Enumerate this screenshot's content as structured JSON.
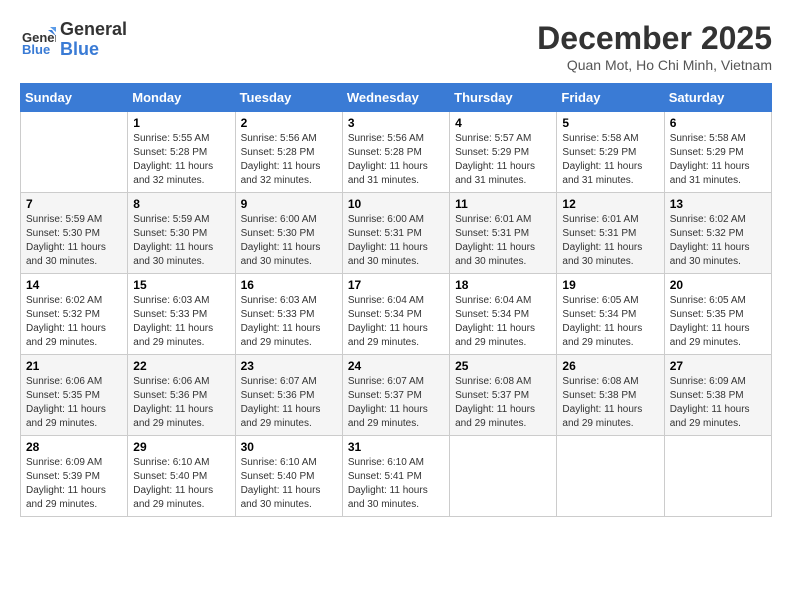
{
  "header": {
    "logo_general": "General",
    "logo_blue": "Blue",
    "month_title": "December 2025",
    "location": "Quan Mot, Ho Chi Minh, Vietnam"
  },
  "days_of_week": [
    "Sunday",
    "Monday",
    "Tuesday",
    "Wednesday",
    "Thursday",
    "Friday",
    "Saturday"
  ],
  "weeks": [
    [
      {
        "day": "",
        "sunrise": "",
        "sunset": "",
        "daylight": ""
      },
      {
        "day": "1",
        "sunrise": "Sunrise: 5:55 AM",
        "sunset": "Sunset: 5:28 PM",
        "daylight": "Daylight: 11 hours and 32 minutes."
      },
      {
        "day": "2",
        "sunrise": "Sunrise: 5:56 AM",
        "sunset": "Sunset: 5:28 PM",
        "daylight": "Daylight: 11 hours and 32 minutes."
      },
      {
        "day": "3",
        "sunrise": "Sunrise: 5:56 AM",
        "sunset": "Sunset: 5:28 PM",
        "daylight": "Daylight: 11 hours and 31 minutes."
      },
      {
        "day": "4",
        "sunrise": "Sunrise: 5:57 AM",
        "sunset": "Sunset: 5:29 PM",
        "daylight": "Daylight: 11 hours and 31 minutes."
      },
      {
        "day": "5",
        "sunrise": "Sunrise: 5:58 AM",
        "sunset": "Sunset: 5:29 PM",
        "daylight": "Daylight: 11 hours and 31 minutes."
      },
      {
        "day": "6",
        "sunrise": "Sunrise: 5:58 AM",
        "sunset": "Sunset: 5:29 PM",
        "daylight": "Daylight: 11 hours and 31 minutes."
      }
    ],
    [
      {
        "day": "7",
        "sunrise": "Sunrise: 5:59 AM",
        "sunset": "Sunset: 5:30 PM",
        "daylight": "Daylight: 11 hours and 30 minutes."
      },
      {
        "day": "8",
        "sunrise": "Sunrise: 5:59 AM",
        "sunset": "Sunset: 5:30 PM",
        "daylight": "Daylight: 11 hours and 30 minutes."
      },
      {
        "day": "9",
        "sunrise": "Sunrise: 6:00 AM",
        "sunset": "Sunset: 5:30 PM",
        "daylight": "Daylight: 11 hours and 30 minutes."
      },
      {
        "day": "10",
        "sunrise": "Sunrise: 6:00 AM",
        "sunset": "Sunset: 5:31 PM",
        "daylight": "Daylight: 11 hours and 30 minutes."
      },
      {
        "day": "11",
        "sunrise": "Sunrise: 6:01 AM",
        "sunset": "Sunset: 5:31 PM",
        "daylight": "Daylight: 11 hours and 30 minutes."
      },
      {
        "day": "12",
        "sunrise": "Sunrise: 6:01 AM",
        "sunset": "Sunset: 5:31 PM",
        "daylight": "Daylight: 11 hours and 30 minutes."
      },
      {
        "day": "13",
        "sunrise": "Sunrise: 6:02 AM",
        "sunset": "Sunset: 5:32 PM",
        "daylight": "Daylight: 11 hours and 30 minutes."
      }
    ],
    [
      {
        "day": "14",
        "sunrise": "Sunrise: 6:02 AM",
        "sunset": "Sunset: 5:32 PM",
        "daylight": "Daylight: 11 hours and 29 minutes."
      },
      {
        "day": "15",
        "sunrise": "Sunrise: 6:03 AM",
        "sunset": "Sunset: 5:33 PM",
        "daylight": "Daylight: 11 hours and 29 minutes."
      },
      {
        "day": "16",
        "sunrise": "Sunrise: 6:03 AM",
        "sunset": "Sunset: 5:33 PM",
        "daylight": "Daylight: 11 hours and 29 minutes."
      },
      {
        "day": "17",
        "sunrise": "Sunrise: 6:04 AM",
        "sunset": "Sunset: 5:34 PM",
        "daylight": "Daylight: 11 hours and 29 minutes."
      },
      {
        "day": "18",
        "sunrise": "Sunrise: 6:04 AM",
        "sunset": "Sunset: 5:34 PM",
        "daylight": "Daylight: 11 hours and 29 minutes."
      },
      {
        "day": "19",
        "sunrise": "Sunrise: 6:05 AM",
        "sunset": "Sunset: 5:34 PM",
        "daylight": "Daylight: 11 hours and 29 minutes."
      },
      {
        "day": "20",
        "sunrise": "Sunrise: 6:05 AM",
        "sunset": "Sunset: 5:35 PM",
        "daylight": "Daylight: 11 hours and 29 minutes."
      }
    ],
    [
      {
        "day": "21",
        "sunrise": "Sunrise: 6:06 AM",
        "sunset": "Sunset: 5:35 PM",
        "daylight": "Daylight: 11 hours and 29 minutes."
      },
      {
        "day": "22",
        "sunrise": "Sunrise: 6:06 AM",
        "sunset": "Sunset: 5:36 PM",
        "daylight": "Daylight: 11 hours and 29 minutes."
      },
      {
        "day": "23",
        "sunrise": "Sunrise: 6:07 AM",
        "sunset": "Sunset: 5:36 PM",
        "daylight": "Daylight: 11 hours and 29 minutes."
      },
      {
        "day": "24",
        "sunrise": "Sunrise: 6:07 AM",
        "sunset": "Sunset: 5:37 PM",
        "daylight": "Daylight: 11 hours and 29 minutes."
      },
      {
        "day": "25",
        "sunrise": "Sunrise: 6:08 AM",
        "sunset": "Sunset: 5:37 PM",
        "daylight": "Daylight: 11 hours and 29 minutes."
      },
      {
        "day": "26",
        "sunrise": "Sunrise: 6:08 AM",
        "sunset": "Sunset: 5:38 PM",
        "daylight": "Daylight: 11 hours and 29 minutes."
      },
      {
        "day": "27",
        "sunrise": "Sunrise: 6:09 AM",
        "sunset": "Sunset: 5:38 PM",
        "daylight": "Daylight: 11 hours and 29 minutes."
      }
    ],
    [
      {
        "day": "28",
        "sunrise": "Sunrise: 6:09 AM",
        "sunset": "Sunset: 5:39 PM",
        "daylight": "Daylight: 11 hours and 29 minutes."
      },
      {
        "day": "29",
        "sunrise": "Sunrise: 6:10 AM",
        "sunset": "Sunset: 5:40 PM",
        "daylight": "Daylight: 11 hours and 29 minutes."
      },
      {
        "day": "30",
        "sunrise": "Sunrise: 6:10 AM",
        "sunset": "Sunset: 5:40 PM",
        "daylight": "Daylight: 11 hours and 30 minutes."
      },
      {
        "day": "31",
        "sunrise": "Sunrise: 6:10 AM",
        "sunset": "Sunset: 5:41 PM",
        "daylight": "Daylight: 11 hours and 30 minutes."
      },
      {
        "day": "",
        "sunrise": "",
        "sunset": "",
        "daylight": ""
      },
      {
        "day": "",
        "sunrise": "",
        "sunset": "",
        "daylight": ""
      },
      {
        "day": "",
        "sunrise": "",
        "sunset": "",
        "daylight": ""
      }
    ]
  ]
}
